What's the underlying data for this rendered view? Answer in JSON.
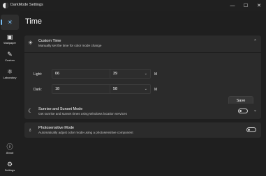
{
  "window": {
    "title": "DarkMode Settings",
    "minimize_glyph": "—",
    "maximize_glyph": "☐",
    "close_glyph": "✕"
  },
  "sidebar": {
    "items": [
      {
        "name": "time",
        "icon": "☀",
        "label": ""
      },
      {
        "name": "wallpaper",
        "icon": "▣",
        "label": "Wallpaper"
      },
      {
        "name": "custom",
        "icon": "✎",
        "label": "Custom"
      },
      {
        "name": "laboratory",
        "icon": "⚛",
        "label": "Laboratory"
      },
      {
        "name": "about",
        "icon": "ⓘ",
        "label": "About"
      },
      {
        "name": "settings",
        "icon": "⚙",
        "label": "Settings"
      }
    ]
  },
  "page": {
    "title": "Time"
  },
  "custom_time": {
    "icon": "☀",
    "title": "Custom Time",
    "description": "Manually set the time for color mode change",
    "chevron": "⌃",
    "light_label": "Light:",
    "dark_label": "Dark:",
    "light_hour": "06",
    "light_minute": "39",
    "dark_hour": "18",
    "dark_minute": "58",
    "hour_unit": "H",
    "minute_unit": "M",
    "dropdown_glyph": "⌄",
    "save_label": "Save"
  },
  "sunrise": {
    "icon": "☾",
    "title": "Sunrise and Sunset Mode",
    "description": "Get sunrise and sunset times using Windows location services",
    "chevron": "⌄",
    "enabled": false
  },
  "photosensitive": {
    "icon": "♁",
    "title": "Photosensitive Mode",
    "description": "Automatically adjust color mode using a photosensitive component",
    "enabled": false
  },
  "colors": {
    "background": "#1c1c1c",
    "card": "#2b2b2b",
    "accent": "#76b9ed"
  }
}
